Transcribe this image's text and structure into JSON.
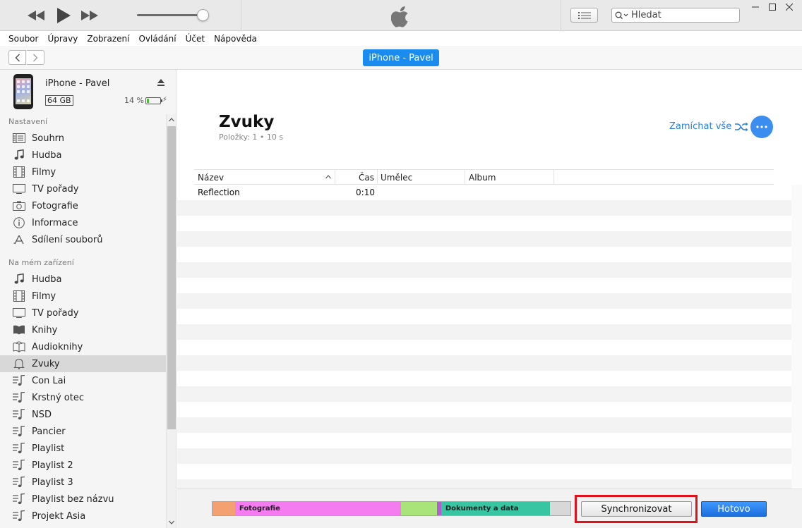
{
  "menu": [
    "Soubor",
    "Úpravy",
    "Zobrazení",
    "Ovládání",
    "Účet",
    "Nápověda"
  ],
  "search": {
    "placeholder": "Hledat"
  },
  "navbar": {
    "device_button": "iPhone - Pavel"
  },
  "device": {
    "name": "iPhone - Pavel",
    "capacity": "64 GB",
    "battery_pct": "14 %",
    "battery_level": 0.14
  },
  "sidebar": {
    "section_settings": "Nastavení",
    "settings_items": [
      {
        "label": "Souhrn",
        "icon": "summary-icon"
      },
      {
        "label": "Hudba",
        "icon": "music-note-icon"
      },
      {
        "label": "Filmy",
        "icon": "film-icon"
      },
      {
        "label": "TV pořady",
        "icon": "tv-icon"
      },
      {
        "label": "Fotografie",
        "icon": "camera-icon"
      },
      {
        "label": "Informace",
        "icon": "info-icon"
      },
      {
        "label": "Sdílení souborů",
        "icon": "app-store-icon"
      }
    ],
    "section_device": "Na mém zařízení",
    "device_items": [
      {
        "label": "Hudba",
        "icon": "music-note-icon"
      },
      {
        "label": "Filmy",
        "icon": "film-icon"
      },
      {
        "label": "TV pořady",
        "icon": "tv-icon"
      },
      {
        "label": "Knihy",
        "icon": "book-icon"
      },
      {
        "label": "Audioknihy",
        "icon": "audiobook-icon"
      },
      {
        "label": "Zvuky",
        "icon": "bell-icon",
        "active": true
      },
      {
        "label": "Con Lai",
        "icon": "playlist-icon"
      },
      {
        "label": "Krstný otec",
        "icon": "playlist-icon"
      },
      {
        "label": "NSD",
        "icon": "playlist-icon"
      },
      {
        "label": "Pancier",
        "icon": "playlist-icon"
      },
      {
        "label": "Playlist",
        "icon": "playlist-icon"
      },
      {
        "label": "Playlist 2",
        "icon": "playlist-icon"
      },
      {
        "label": "Playlist 3",
        "icon": "playlist-icon"
      },
      {
        "label": "Playlist bez názvu",
        "icon": "playlist-icon"
      },
      {
        "label": "Projekt Asia",
        "icon": "playlist-icon"
      }
    ]
  },
  "main": {
    "title": "Zvuky",
    "subtitle": "Položky: 1 • 10 s",
    "shuffle_label": "Zamíchat vše",
    "columns": [
      "Název",
      "Čas",
      "Umělec",
      "Album"
    ],
    "rows": [
      {
        "name": "Reflection",
        "time": "0:10",
        "artist": "",
        "album": ""
      }
    ]
  },
  "bottom": {
    "storage_segments": [
      {
        "label": "",
        "color": "#f5a070",
        "fraction": 0.063
      },
      {
        "label": "Fotografie",
        "color": "#f47cf0",
        "fraction": 0.465
      },
      {
        "label": "",
        "color": "#a8e47a",
        "fraction": 0.1
      },
      {
        "label": "",
        "color": "#b25fd0",
        "fraction": 0.01
      },
      {
        "label": "Dokumenty a data",
        "color": "#37c5a2",
        "fraction": 0.305
      },
      {
        "label": "",
        "color": "#d8d8d8",
        "fraction": 0.057
      }
    ],
    "sync_button": "Synchronizovat",
    "done_button": "Hotovo"
  },
  "colors": {
    "accent": "#1a8cf0",
    "highlight": "#e0111b"
  }
}
